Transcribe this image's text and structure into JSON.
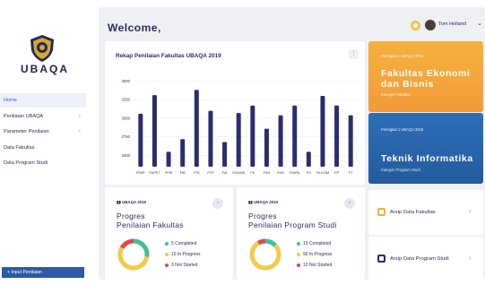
{
  "sidebar": {
    "brand": "UBAQA",
    "items": [
      {
        "label": "Home",
        "active": true,
        "chevron": false
      },
      {
        "label": "Penilaian UBAQA",
        "active": false,
        "chevron": true
      },
      {
        "label": "Parameter Penilaian",
        "active": false,
        "chevron": true
      },
      {
        "label": "Data Fakultas",
        "active": false,
        "chevron": false
      },
      {
        "label": "Data Program Studi",
        "active": false,
        "chevron": false
      }
    ],
    "input_button": "+ Input Penilaian"
  },
  "header": {
    "welcome": "Welcome,",
    "user_name": "Tom Holland",
    "chevron": "⌄",
    "notification_icon": "bell-icon"
  },
  "chart_card": {
    "title": "Rekap Penilaian Fakultas UBAQA 2019",
    "menu_icon": "⋮"
  },
  "chart_data": {
    "type": "bar",
    "title": "Rekap Penilaian Fakultas UBAQA 2019",
    "categories": [
      "FISIP",
      "FAPET",
      "FPIK",
      "FIB",
      "FTE",
      "FTP",
      "FIA",
      "VOKASI",
      "FK",
      "FKH",
      "FKG",
      "FMIPA",
      "FH",
      "FILKOM",
      "FP",
      "FT"
    ],
    "values": [
      3060,
      3310,
      2550,
      2720,
      3380,
      3100,
      2680,
      3070,
      3170,
      2860,
      3040,
      3170,
      2550,
      3300,
      3170,
      3040
    ],
    "yticks": [
      2500,
      2750,
      3000,
      3250,
      3500
    ],
    "ylim": [
      2350,
      3600
    ],
    "color": "#2b2e6e",
    "grid": true
  },
  "info_cards": [
    {
      "tag": "Peringkat 1 UBAQA 2019",
      "title_line1": "Fakultas Ekonomi",
      "title_line2": "dan Bisnis",
      "subtitle": "Kategori Fakultas"
    },
    {
      "tag": "Peringkat 1 UBAQA 2019",
      "title_line1": "Teknik Informatika",
      "subtitle": "Kategori Program Studi"
    }
  ],
  "progress_cards": [
    {
      "tag": "UBAQA 2019",
      "title_line1": "Progres",
      "title_line2": "Penilaian Fakultas",
      "legend": [
        {
          "label": "5 Completed",
          "value": 5,
          "color": "#3ec28f"
        },
        {
          "label": "10 In Progress",
          "value": 10,
          "color": "#f3c94a"
        },
        {
          "label": "3 Not Started",
          "value": 3,
          "color": "#e04a4a"
        }
      ]
    },
    {
      "tag": "UBAQA 2019",
      "title_line1": "Progres",
      "title_line2": "Penilaian Program Studi",
      "legend": [
        {
          "label": "15 Completed",
          "value": 15,
          "color": "#3ec28f"
        },
        {
          "label": "90 In Progress",
          "value": 90,
          "color": "#f3c94a"
        },
        {
          "label": "10 Not Started",
          "value": 10,
          "color": "#e04a4a"
        }
      ]
    }
  ],
  "archive_cards": [
    {
      "label": "Arsip Data Fakultas",
      "icon_color": "#f5b13c",
      "chevron": "›"
    },
    {
      "label": "Arsip Data Program Studi",
      "icon_color": "#2b2e6e",
      "chevron": "›"
    }
  ],
  "colors": {
    "accent": "#3a5bd8",
    "navy": "#2b2e5c",
    "orange": "#f5b13c",
    "blue": "#2d6fb8"
  }
}
